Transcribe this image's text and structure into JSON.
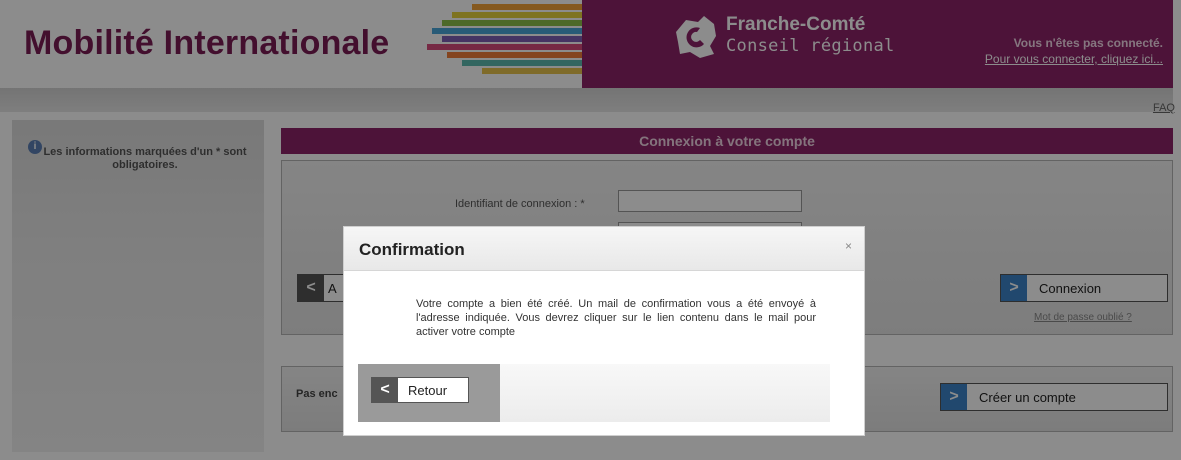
{
  "header": {
    "brand_title": "Mobilité Internationale",
    "region_name": "Franche-Comté",
    "region_subtitle": "Conseil régional",
    "status_text": "Vous n'êtes pas connecté.",
    "connect_link": "Pour vous connecter, cliquez ici...",
    "band_color": "#8d2468"
  },
  "toolbar": {
    "faq_label": "FAQ"
  },
  "sidebar": {
    "info_icon": "info-icon",
    "note": "Les informations marquées d'un * sont obligatoires."
  },
  "login": {
    "panel_title": "Connexion à votre compte",
    "id_label": "Identifiant de connexion : *",
    "id_value": "",
    "password_value": "",
    "back_label": "A",
    "connexion_label": "Connexion",
    "forgot_label": "Mot de passe oublié ?"
  },
  "signup": {
    "text": "Pas enc",
    "create_label": "Créer un compte"
  },
  "modal": {
    "title": "Confirmation",
    "close_glyph": "×",
    "message": "Votre compte a bien été créé. Un mail de confirmation vous a été envoyé à l'adresse indiquée. Vous devrez cliquer sur le lien contenu dans le mail pour activer votre compte",
    "retour_label": "Retour",
    "chevron_glyph": "<",
    "next_glyph": ">"
  }
}
